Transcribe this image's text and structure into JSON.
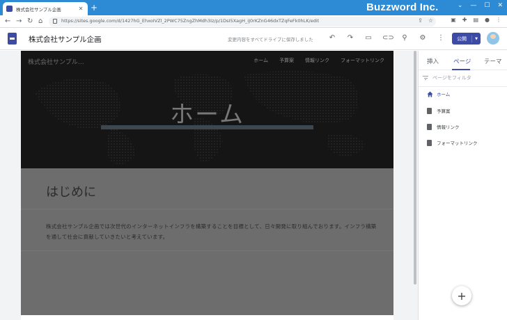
{
  "browser": {
    "tab_title": "株式会社サンプル企画",
    "tab_close": "✕",
    "new_tab": "+",
    "url": "https://sites.google.com/d/1427hG_EhxoIVZl_2PWC75ZngZhMdh3Iz/p/1DsI5XagH_iJ0rKZnG46dxTZqFeFk0hLK/edit",
    "brand_overlay": "Buzzword Inc."
  },
  "toolbar": {
    "site_title": "株式会社サンプル企画",
    "save_status": "変更内容をすべてドライブに保存しました",
    "publish_label": "公開"
  },
  "hero": {
    "site_name": "株式会社サンプル…",
    "nav": [
      "ホーム",
      "予算案",
      "情報リンク",
      "フォーマットリンク"
    ],
    "title": "ホーム"
  },
  "content": {
    "section_title": "はじめに",
    "section_text": "株式会社サンプル企画では次世代のインターネットインフラを構築することを目標として、日々開発に取り組んでおります。インフラ構築を通して社会に貢献していきたいと考えています。"
  },
  "panel": {
    "tabs": [
      "挿入",
      "ページ",
      "テーマ"
    ],
    "filter_placeholder": "ページをフィルタ",
    "pages": [
      "ホーム",
      "予算案",
      "情報リンク",
      "フォーマットリンク"
    ]
  },
  "fab_label": "+",
  "colors": {
    "accent": "#3c4ba6",
    "chrome": "#2d8ad4"
  }
}
